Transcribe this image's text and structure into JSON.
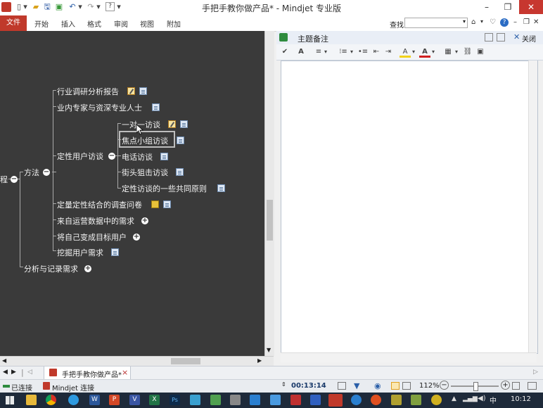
{
  "window": {
    "title": "手把手教你做产品* - Mindjet 专业版",
    "minimize": "–",
    "restore": "❐",
    "close": "✕"
  },
  "quick_access": [
    "▯",
    "▾",
    "🖫",
    "▣",
    "↶",
    "▾",
    "↷",
    "▾",
    "?",
    "▾"
  ],
  "ribbon": {
    "tabs": [
      "文件",
      "开始",
      "插入",
      "格式",
      "审阅",
      "视图",
      "附加"
    ],
    "find_label": "查找",
    "find_value": "",
    "find_arrow": "▾",
    "right_icons": [
      "⌂",
      "▾",
      "♡",
      "?",
      "–",
      "❐",
      "✕"
    ]
  },
  "map": {
    "root_partial": "程",
    "nodes": {
      "methods": "方法",
      "industry_report": "行业调研分析报告",
      "experts": "业内专家与资深专业人士",
      "qualitative": "定性用户访谈",
      "one_on_one": "一对一访谈",
      "focus_group": "焦点小组访谈",
      "phone": "电话访谈",
      "street": "街头狙击访谈",
      "principles": "定性访谈的一些共同原则",
      "survey": "定量定性结合的调查问卷",
      "ops_data": "来自运营数据中的需求",
      "become_user": "将自己变成目标用户",
      "dig_needs": "挖掘用户需求",
      "analysis": "分析与记录需求"
    },
    "expand_symbol": "+",
    "collapse_symbol": "−"
  },
  "notes": {
    "title": "主题备注",
    "close_label": "关闭",
    "close_icon": "✕",
    "toolbar": [
      "✔",
      "A",
      "≡",
      "▾",
      "⁝≡",
      "▾",
      "•≡",
      "⇤",
      "⇥",
      "A",
      "▾",
      "A",
      "▾",
      "▦",
      "▾",
      "⛓",
      "▣"
    ]
  },
  "doc_tabs": {
    "nav": [
      "◀",
      "▶",
      "|",
      "◁"
    ],
    "active_label": "手把手教你做产品*",
    "close": "×",
    "right_arrow": "▷"
  },
  "status": {
    "connection": "已连接",
    "mindjet_link": "Mindjet 连接",
    "timer": "00:13:14",
    "zoom": "112%",
    "zoom_minus": "−",
    "zoom_plus": "+"
  },
  "taskbar": {
    "time": "10:12",
    "ime": "中",
    "apps": [
      "W",
      "P",
      "V",
      "X",
      "Ps"
    ]
  },
  "colors": {
    "canvas": "#3a3a3a",
    "file_tab": "#c0392b",
    "close_btn": "#c7372f",
    "taskbar": "#1e2a3a"
  }
}
